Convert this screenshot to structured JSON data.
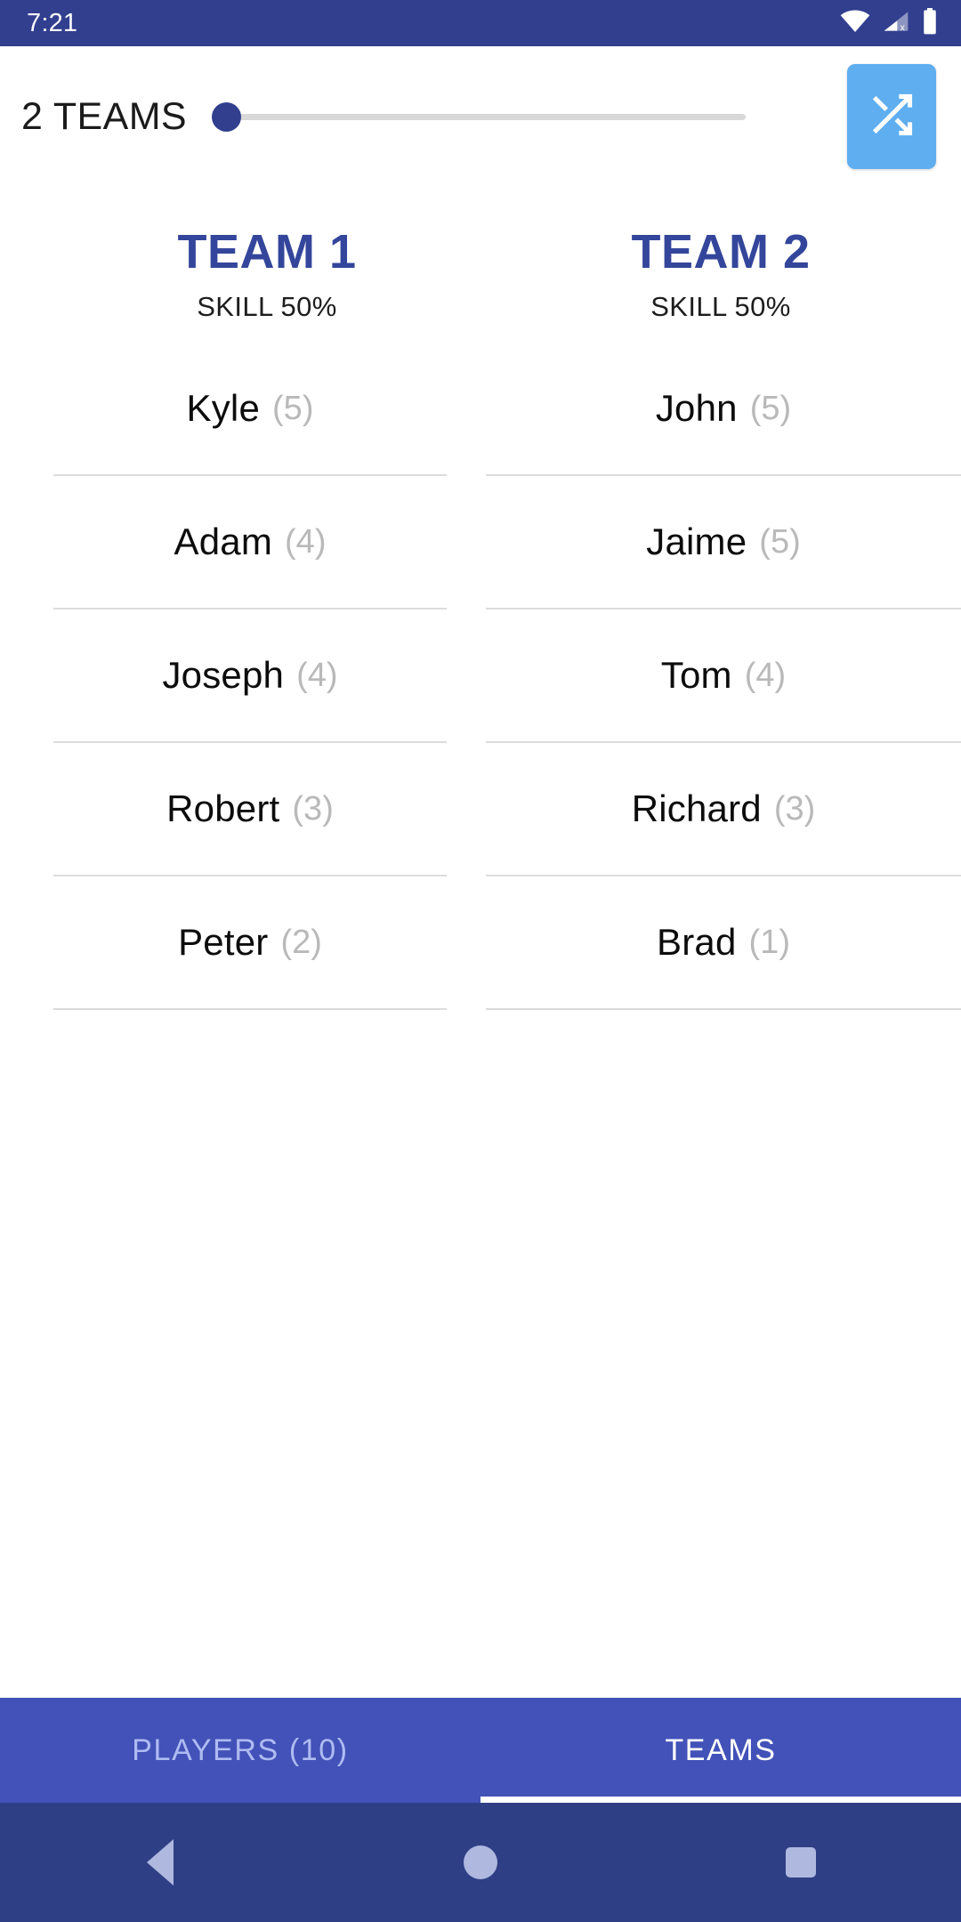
{
  "status_bar": {
    "time": "7:21",
    "icons": [
      "wifi-icon",
      "cellular-no-sim-icon",
      "battery-icon"
    ],
    "background": "#313f8e"
  },
  "top_bar": {
    "teams_count_label": "2 TEAMS",
    "slider": {
      "value": 2,
      "min": 2,
      "max": 10,
      "thumb_position_percent": 0
    },
    "shuffle_button": {
      "icon": "shuffle-icon",
      "color": "#5eaef0"
    }
  },
  "teams": [
    {
      "title": "TEAM 1",
      "skill_label": "SKILL 50%",
      "players": [
        {
          "name": "Kyle",
          "score": "(5)"
        },
        {
          "name": "Adam",
          "score": "(4)"
        },
        {
          "name": "Joseph",
          "score": "(4)"
        },
        {
          "name": "Robert",
          "score": "(3)"
        },
        {
          "name": "Peter",
          "score": "(2)"
        }
      ]
    },
    {
      "title": "TEAM 2",
      "skill_label": "SKILL 50%",
      "players": [
        {
          "name": "John",
          "score": "(5)"
        },
        {
          "name": "Jaime",
          "score": "(5)"
        },
        {
          "name": "Tom",
          "score": "(4)"
        },
        {
          "name": "Richard",
          "score": "(3)"
        },
        {
          "name": "Brad",
          "score": "(1)"
        }
      ]
    }
  ],
  "tab_bar": {
    "background": "#4352b8",
    "tabs": [
      {
        "label": "PLAYERS (10)",
        "active": false
      },
      {
        "label": "TEAMS",
        "active": true
      }
    ]
  },
  "nav_bar": {
    "buttons": [
      "back-icon",
      "home-icon",
      "recents-icon"
    ],
    "background": "#2f3f85"
  },
  "colors": {
    "primary_dark": "#313f8e",
    "team_title": "#34469b",
    "accent_blue": "#5eaef0",
    "tab_active": "#ffffff",
    "tab_inactive": "#aebcf2",
    "score_grey": "#b9b9b9"
  }
}
